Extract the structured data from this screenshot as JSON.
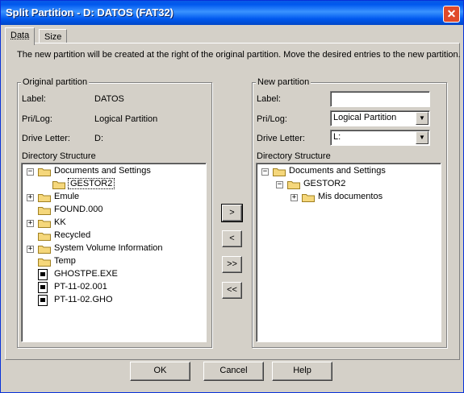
{
  "window": {
    "title": "Split Partition - D: DATOS (FAT32)",
    "close_glyph": "✕"
  },
  "tabs": [
    {
      "label": "Data"
    },
    {
      "label": "Size"
    }
  ],
  "description": "The new partition will be created at the right of the original partition. Move the desired entries to the new partition.",
  "original": {
    "group_title": "Original partition",
    "label_caption": "Label:",
    "label_value": "DATOS",
    "prilog_caption": "Pri/Log:",
    "prilog_value": "Logical Partition",
    "drive_caption": "Drive Letter:",
    "drive_value": "D:",
    "dir_caption": "Directory Structure",
    "tree": [
      {
        "text": "Documents and Settings",
        "kind": "folder",
        "expander": "−"
      },
      {
        "text": "GESTOR2",
        "kind": "folder",
        "expander": ""
      },
      {
        "text": "Emule",
        "kind": "folder",
        "expander": "+"
      },
      {
        "text": "FOUND.000",
        "kind": "folder",
        "expander": ""
      },
      {
        "text": "KK",
        "kind": "folder",
        "expander": "+"
      },
      {
        "text": "Recycled",
        "kind": "folder",
        "expander": ""
      },
      {
        "text": "System Volume Information",
        "kind": "folder",
        "expander": "+"
      },
      {
        "text": "Temp",
        "kind": "folder",
        "expander": ""
      },
      {
        "text": "GHOSTPE.EXE",
        "kind": "file",
        "expander": ""
      },
      {
        "text": "PT-11-02.001",
        "kind": "file",
        "expander": ""
      },
      {
        "text": "PT-11-02.GHO",
        "kind": "file",
        "expander": ""
      }
    ]
  },
  "new_partition": {
    "group_title": "New partition",
    "label_caption": "Label:",
    "label_value": "",
    "prilog_caption": "Pri/Log:",
    "prilog_value": "Logical Partition",
    "drive_caption": "Drive Letter:",
    "drive_value": "L:",
    "dir_caption": "Directory Structure",
    "tree": [
      {
        "text": "Documents and Settings",
        "kind": "folder",
        "expander": "−"
      },
      {
        "text": "GESTOR2",
        "kind": "folder",
        "expander": "−"
      },
      {
        "text": "Mis documentos",
        "kind": "folder",
        "expander": "+"
      }
    ]
  },
  "move_buttons": {
    "move_right": ">",
    "move_left": "<",
    "move_all_right": ">>",
    "move_all_left": "<<"
  },
  "dialog_buttons": {
    "ok": "OK",
    "cancel": "Cancel",
    "help": "Help"
  },
  "colors": {
    "titlebar": "#0058ee",
    "selection": "#316ac5",
    "folder": "#f5d77b"
  }
}
